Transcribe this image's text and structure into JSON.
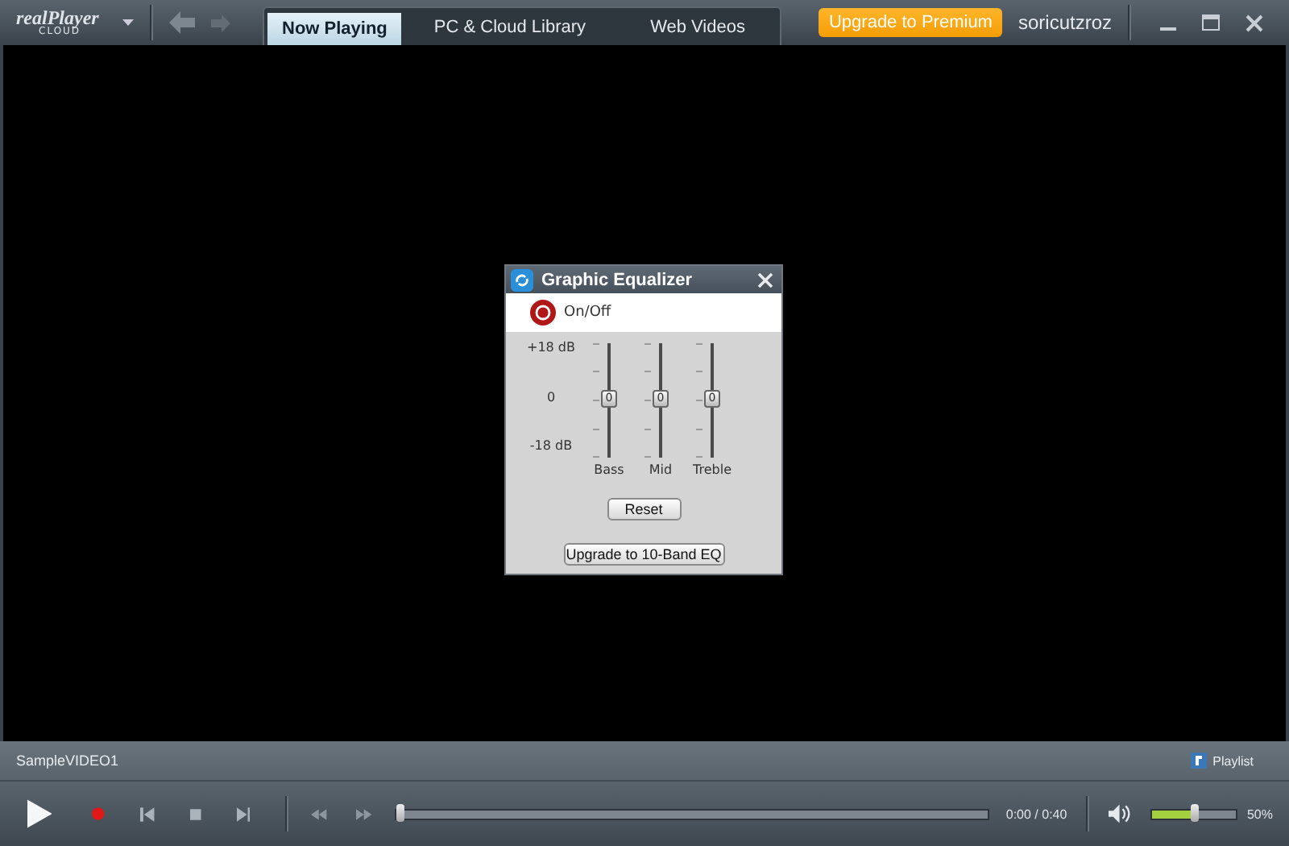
{
  "app": {
    "logo": "realPlayer",
    "logo_sub": "CLOUD"
  },
  "tabs": [
    {
      "label": "Now Playing",
      "selected": true
    },
    {
      "label": "PC & Cloud Library",
      "selected": false
    },
    {
      "label": "Web Videos",
      "selected": false
    }
  ],
  "upgrade_button": "Upgrade to Premium",
  "user": "soricutzroz",
  "equalizer": {
    "title": "Graphic Equalizer",
    "power": {
      "label": "On/Off",
      "on": true
    },
    "scale": [
      "+18 dB",
      "0",
      "-18 dB"
    ],
    "bands": [
      {
        "name": "Bass",
        "level": 0.5,
        "value": "0"
      },
      {
        "name": "Mid",
        "level": 0.5,
        "value": "0"
      },
      {
        "name": "Treble",
        "level": 0.5,
        "value": "0"
      }
    ],
    "reset": "Reset",
    "upgrade": "Upgrade to 10-Band EQ"
  },
  "now_playing": "SampleVIDEO1",
  "playlist": "Playlist",
  "progress": {
    "level": 0,
    "time": "0:00 / 0:40"
  },
  "volume": {
    "level": 0.5,
    "reading": "50%"
  }
}
